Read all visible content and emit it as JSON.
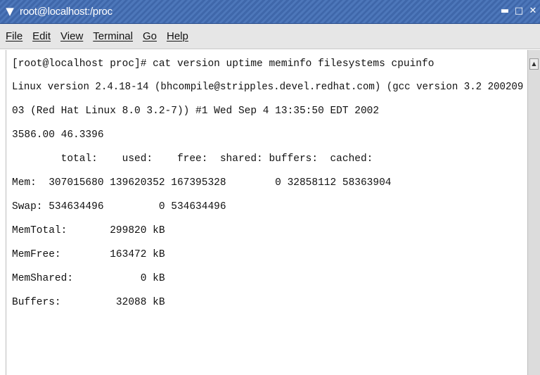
{
  "window": {
    "menu_icon": "▼",
    "title": "root@localhost:/proc",
    "controls": {
      "minimize": "▬",
      "maximize": "□",
      "close": "✕"
    }
  },
  "menubar": {
    "items": [
      "File",
      "Edit",
      "View",
      "Terminal",
      "Go",
      "Help"
    ]
  },
  "terminal": {
    "lines": [
      "[root@localhost proc]# cat version uptime meminfo filesystems cpuinfo",
      "Linux version 2.4.18-14 (bhcompile@stripples.devel.redhat.com) (gcc version 3.2 200209",
      "03 (Red Hat Linux 8.0 3.2-7)) #1 Wed Sep 4 13:35:50 EDT 2002",
      "3586.00 46.3396",
      "        total:    used:    free:  shared: buffers:  cached:",
      "Mem:  307015680 139620352 167395328        0 32858112 58363904",
      "Swap: 534634496         0 534634496",
      "MemTotal:       299820 kB",
      "MemFree:        163472 kB",
      "MemShared:           0 kB",
      "Buffers:         32088 kB"
    ]
  },
  "scrollbar": {
    "up_arrow": "▲"
  }
}
